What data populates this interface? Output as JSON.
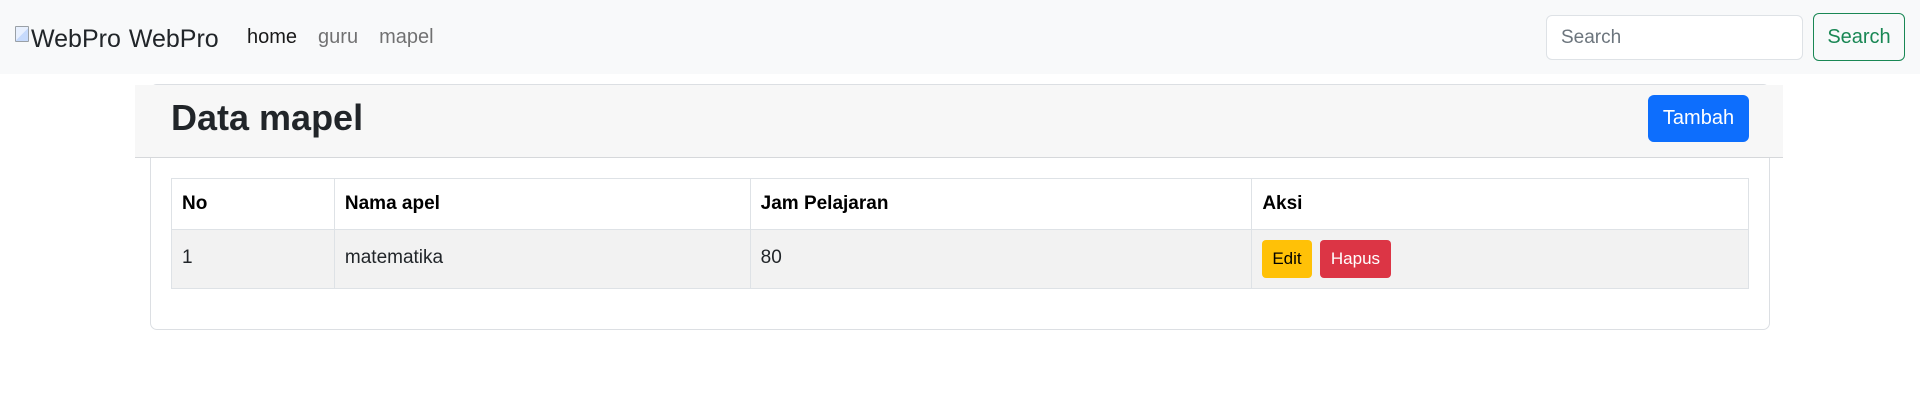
{
  "navbar": {
    "brand_img_alt": "WebPro",
    "brand_name": "WebPro",
    "links": [
      "home",
      "guru",
      "mapel"
    ],
    "search_placeholder": "Search",
    "search_value": "",
    "search_button": "Search"
  },
  "card": {
    "title": "Data mapel",
    "add_button": "Tambah"
  },
  "table": {
    "headers": [
      "No",
      "Nama apel",
      "Jam Pelajaran",
      "Aksi"
    ],
    "rows": [
      {
        "no": "1",
        "nama": "matematika",
        "jam": "80",
        "edit": "Edit",
        "delete": "Hapus"
      }
    ]
  },
  "colors": {
    "navbar_bg": "#f8f9fa",
    "primary": "#0d6efd",
    "success": "#198754",
    "warning": "#ffc107",
    "danger": "#dc3545"
  }
}
